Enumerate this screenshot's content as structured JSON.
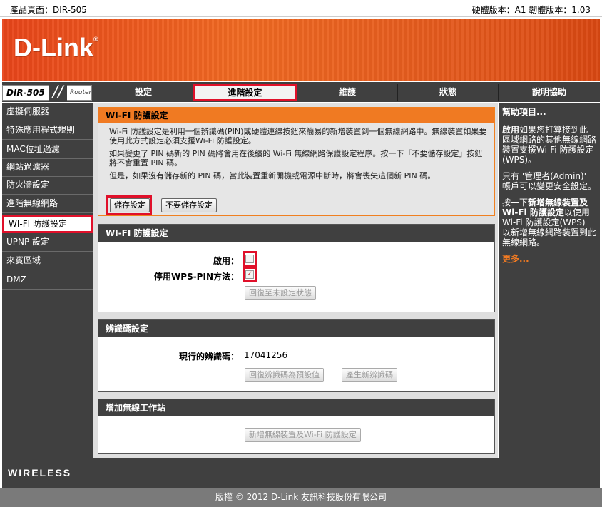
{
  "topbar": {
    "product_page": "產品頁面：DIR-505",
    "versions": "硬體版本：A1   韌體版本：1.03"
  },
  "brand": {
    "logo": "D-Link",
    "model": "DIR-505",
    "router": "Router"
  },
  "nav": {
    "tabs": [
      "設定",
      "進階設定",
      "維護",
      "狀態",
      "說明協助"
    ]
  },
  "sidebar": {
    "items": [
      "虛擬伺服器",
      "特殊應用程式規則",
      "MAC位址過濾",
      "網站過濾器",
      "防火牆設定",
      "進階無線網路",
      "WI-FI 防護設定",
      "UPNP 設定",
      "來賓區域",
      "DMZ"
    ]
  },
  "info": {
    "title": "WI-FI 防護設定",
    "p1": "Wi-Fi 防護設定是利用一個辨識碼(PIN)或硬體連線按鈕來簡易的新增裝置到一個無線網路中。無線裝置如果要使用此方式設定必須支援Wi-Fi 防護設定。",
    "p2": "如果變更了 PIN 碼新的 PIN 碼將會用在後續的 Wi-Fi 無線網路保護設定程序。按一下「不要儲存設定」按鈕將不會重置 PIN 碼。",
    "p3": "但是，如果沒有儲存新的 PIN 碼，當此裝置重新開機或電源中斷時，將會喪失這個新 PIN 碼。",
    "save": "儲存設定",
    "dont_save": "不要儲存設定"
  },
  "wps": {
    "title": "WI-FI 防護設定",
    "enable_label": "啟用：",
    "disable_pin_label": "停用WPS-PIN方法：",
    "reset_button": "回復至未設定狀態"
  },
  "pin": {
    "title": "辨識碼設定",
    "current_label": "現行的辨識碼：",
    "current_value": "17041256",
    "reset_default": "回復辨識碼為預設值",
    "generate": "產生新辨識碼"
  },
  "add_station": {
    "title": "增加無線工作站",
    "button": "新增無線裝置及Wi-Fi 防護設定"
  },
  "help": {
    "title": "幫助項目...",
    "p1_bold": "啟用",
    "p1": "如果您打算接到此區域網路的其他無線網路裝置支援Wi-Fi 防護設定(WPS)。",
    "p2": "只有 '管理者(Admin)' 帳戶可以變更安全設定。",
    "p3_pre": "按一下",
    "p3_bold": "新增無線裝置及Wi-Fi 防護設定",
    "p3_post": "以使用Wi-Fi 防護設定(WPS) 以新增無線網路裝置到此無線網路。",
    "more": "更多..."
  },
  "footer": {
    "wireless": "WIRELESS",
    "copyright": "版權 © 2012 D-Link 友訊科技股份有限公司"
  }
}
